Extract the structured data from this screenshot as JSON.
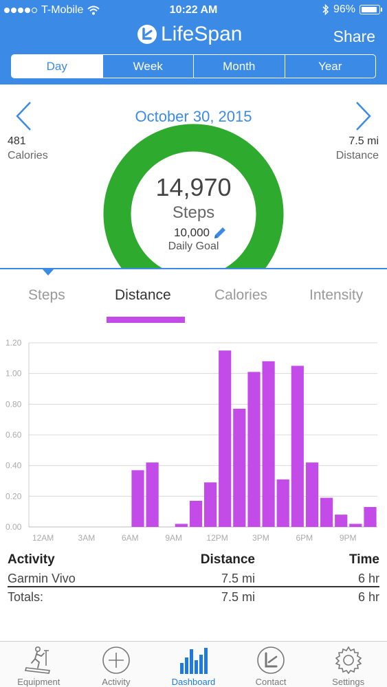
{
  "status_bar": {
    "carrier": "T-Mobile",
    "time": "10:22 AM",
    "battery": "96%"
  },
  "header": {
    "brand": "LifeSpan",
    "share_label": "Share",
    "segments": [
      "Day",
      "Week",
      "Month",
      "Year"
    ],
    "active_segment": "Day"
  },
  "date_label": "October 30, 2015",
  "stats": {
    "calories_value": "481",
    "calories_label": "Calories",
    "distance_value": "7.5 mi",
    "distance_label": "Distance"
  },
  "ring": {
    "steps_value": "14,970",
    "steps_label": "Steps",
    "goal_value": "10,000",
    "goal_label": "Daily Goal",
    "progress": 1.0
  },
  "tabs": {
    "items": [
      "Steps",
      "Distance",
      "Calories",
      "Intensity"
    ],
    "active": "Distance"
  },
  "chart_data": {
    "type": "bar",
    "categories": [
      "12AM",
      "1AM",
      "2AM",
      "3AM",
      "4AM",
      "5AM",
      "6AM",
      "7AM",
      "8AM",
      "9AM",
      "10AM",
      "11AM",
      "12PM",
      "1PM",
      "2PM",
      "3PM",
      "4PM",
      "5PM",
      "6PM",
      "7PM",
      "8PM",
      "9PM",
      "10PM",
      "11PM"
    ],
    "values": [
      0,
      0,
      0,
      0,
      0,
      0,
      0,
      0.37,
      0.42,
      0,
      0.02,
      0.17,
      0.29,
      1.15,
      0.77,
      1.01,
      1.08,
      0.31,
      1.05,
      0.42,
      0.19,
      0.08,
      0.02,
      0.13
    ],
    "x_tick_labels": [
      "12AM",
      "3AM",
      "6AM",
      "9AM",
      "12PM",
      "3PM",
      "6PM",
      "9PM"
    ],
    "y_tick_labels": [
      "0.00",
      "0.20",
      "0.40",
      "0.60",
      "0.80",
      "1.00",
      "1.20"
    ],
    "ylim": [
      0,
      1.2
    ],
    "grid": true,
    "bar_color": "#c34ce8"
  },
  "table": {
    "headers": [
      "Activity",
      "Distance",
      "Time"
    ],
    "rows": [
      [
        "Garmin Vivo",
        "7.5 mi",
        "6 hr"
      ]
    ],
    "totals": [
      "Totals:",
      "7.5 mi",
      "6 hr"
    ]
  },
  "bottom_nav": {
    "items": [
      "Equipment",
      "Activity",
      "Dashboard",
      "Contact",
      "Settings"
    ],
    "active": "Dashboard"
  },
  "colors": {
    "header_blue": "#3b8be6",
    "ring_green": "#2eaa2e",
    "accent_purple": "#c34ce8"
  }
}
